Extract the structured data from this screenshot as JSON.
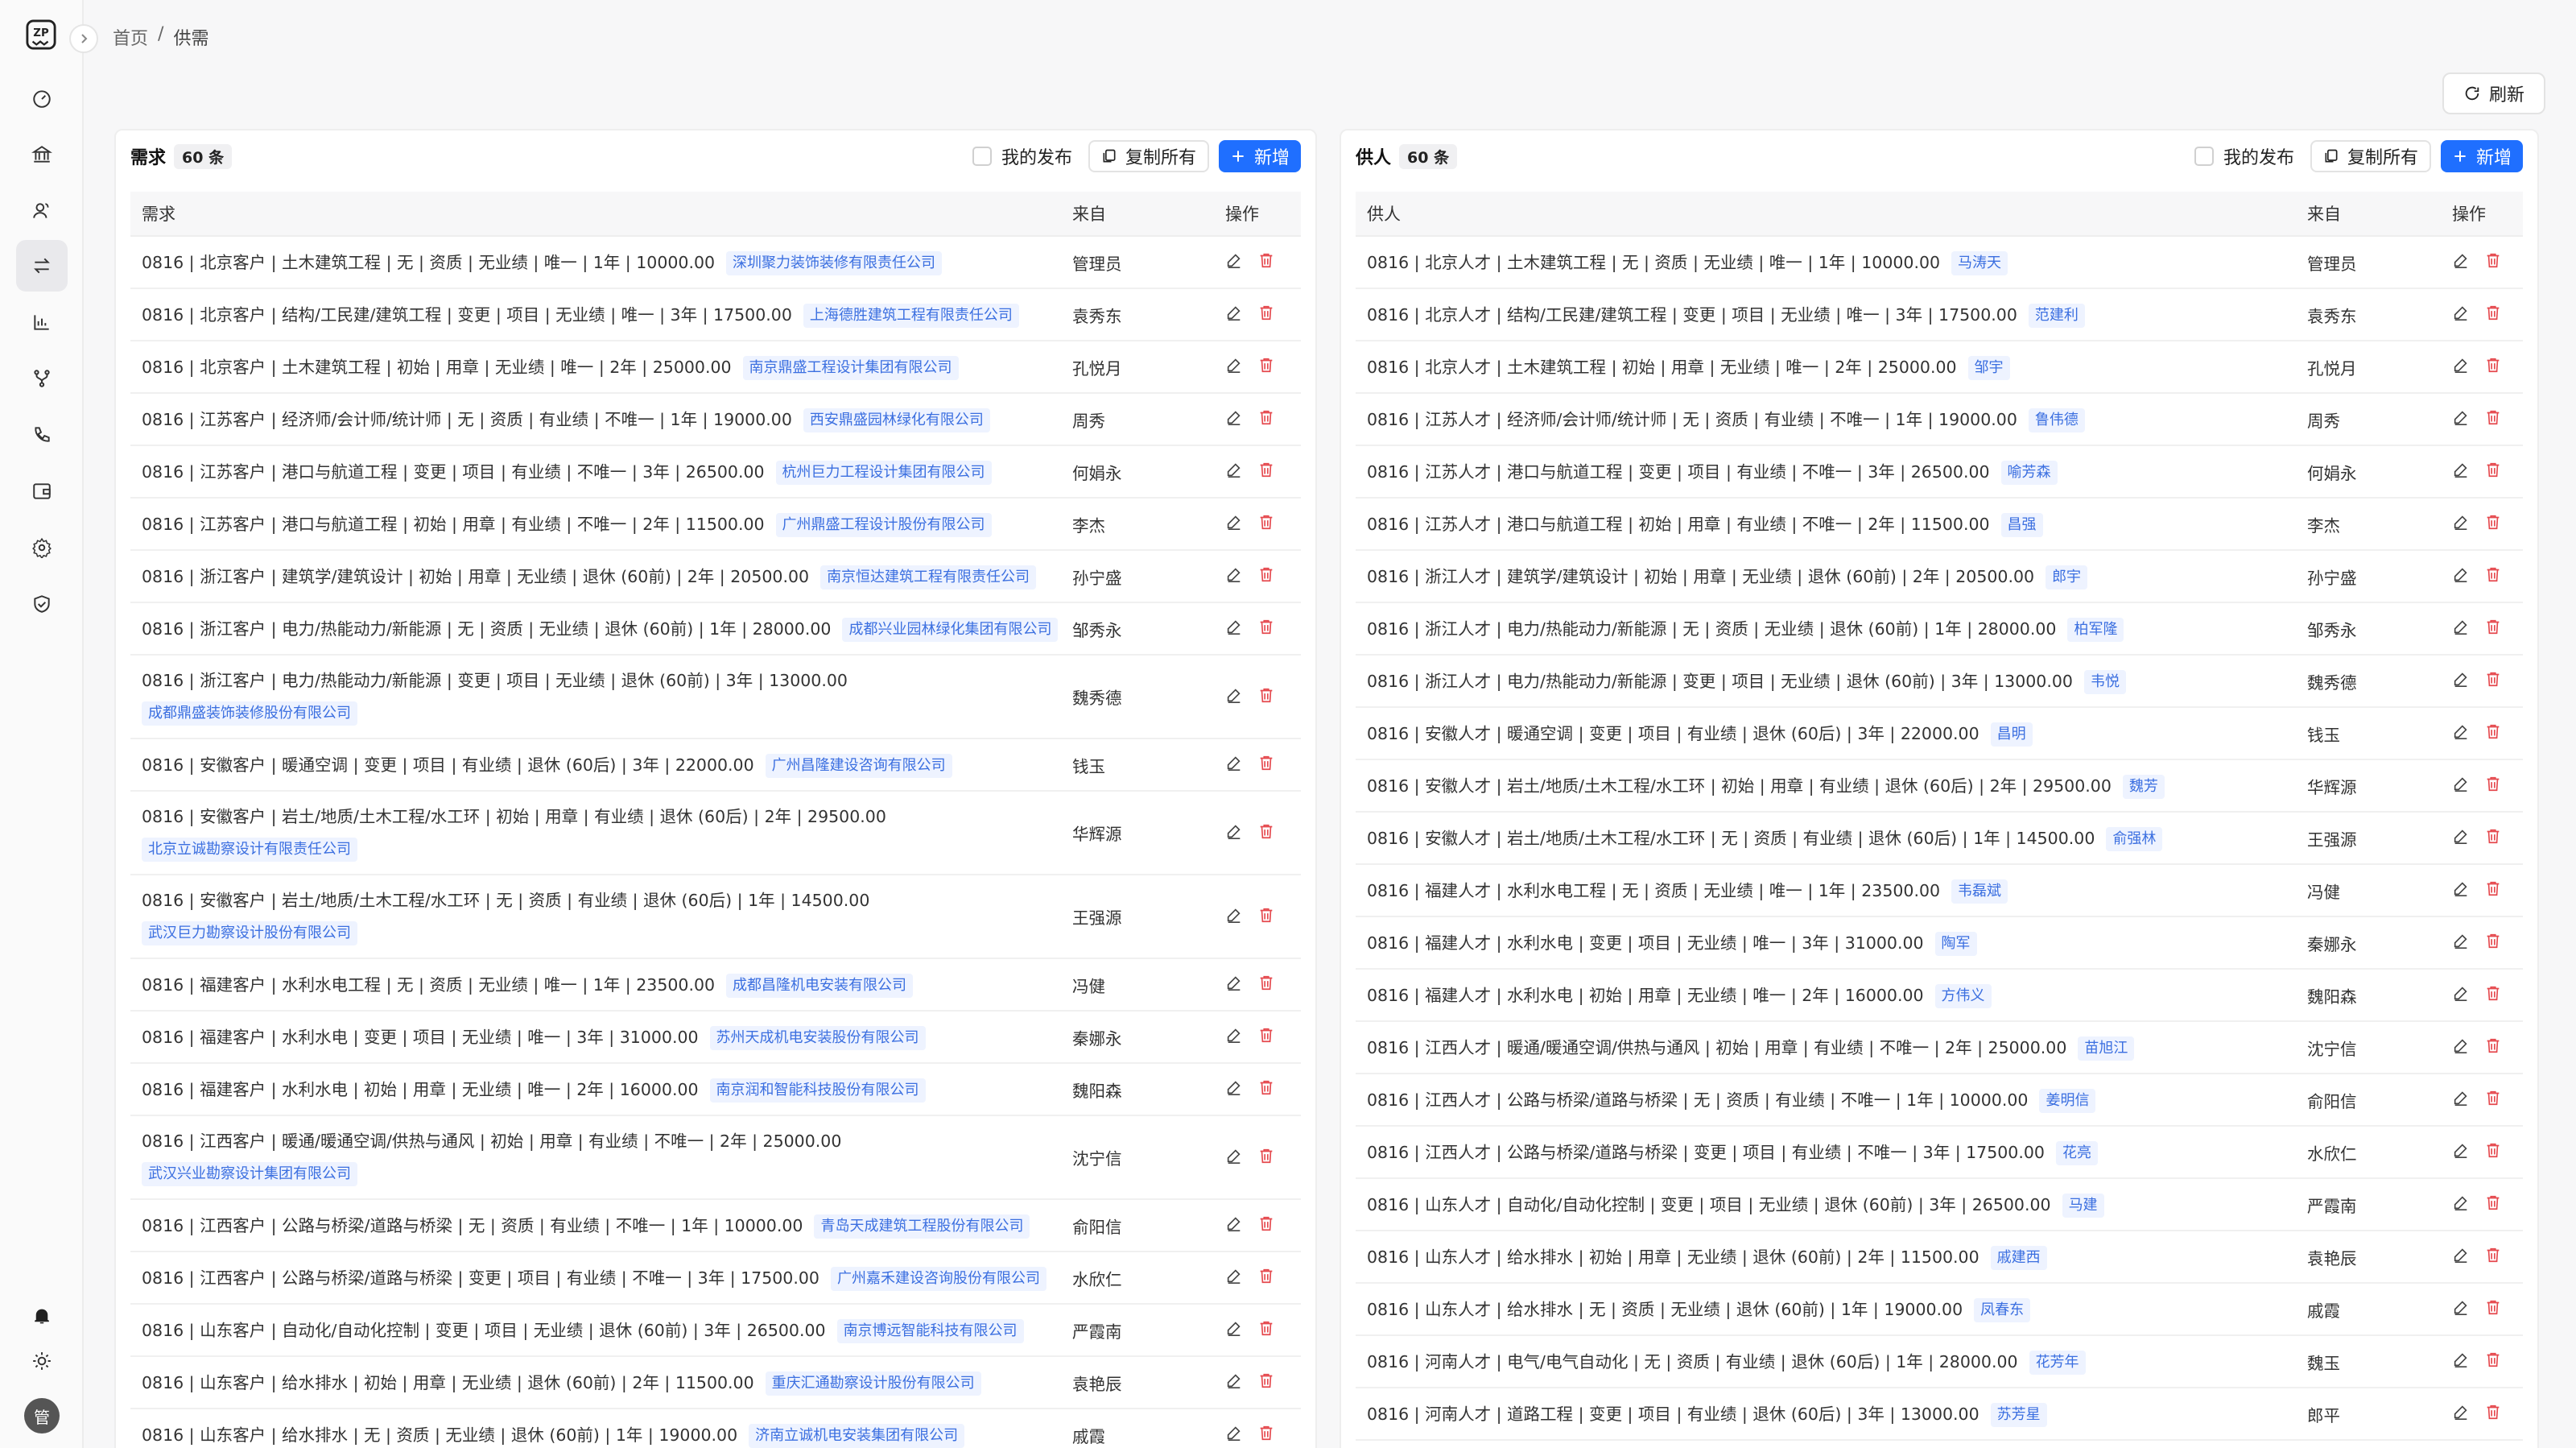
{
  "sidebar": {
    "logo": "ZP",
    "nav": [
      {
        "icon": "dashboard-icon",
        "active": false
      },
      {
        "icon": "bank-icon",
        "active": false
      },
      {
        "icon": "users-icon",
        "active": false
      },
      {
        "icon": "exchange-icon",
        "active": true
      },
      {
        "icon": "chart-icon",
        "active": false
      },
      {
        "icon": "branch-icon",
        "active": false
      },
      {
        "icon": "phone-icon",
        "active": false
      },
      {
        "icon": "wallet-icon",
        "active": false
      },
      {
        "icon": "settings-icon",
        "active": false
      },
      {
        "icon": "shield-icon",
        "active": false
      }
    ],
    "bottom": [
      {
        "icon": "bell-icon"
      },
      {
        "icon": "sun-icon"
      }
    ],
    "avatar_text": "管"
  },
  "breadcrumb": {
    "home": "首页",
    "sep": "/",
    "current": "供需"
  },
  "toolbar": {
    "refresh_label": "刷新"
  },
  "demand": {
    "title": "需求",
    "count": "60 条",
    "my_posts_label": "我的发布",
    "copy_label": "复制所有",
    "add_label": "新增",
    "columns": {
      "main": "需求",
      "from": "来自",
      "op": "操作"
    },
    "rows": [
      {
        "text": "0816 | 北京客户 | 土木建筑工程 | 无 | 资质 | 无业绩 | 唯一 | 1年 | 10000.00",
        "tag": "深圳聚力装饰装修有限责任公司",
        "from": "管理员",
        "tall": false
      },
      {
        "text": "0816 | 北京客户 | 结构/工民建/建筑工程 | 变更 | 项目 | 无业绩 | 唯一 | 3年 | 17500.00",
        "tag": "上海德胜建筑工程有限责任公司",
        "from": "袁秀东",
        "tall": false
      },
      {
        "text": "0816 | 北京客户 | 土木建筑工程 | 初始 | 用章 | 无业绩 | 唯一 | 2年 | 25000.00",
        "tag": "南京鼎盛工程设计集团有限公司",
        "from": "孔悦月",
        "tall": false
      },
      {
        "text": "0816 | 江苏客户 | 经济师/会计师/统计师 | 无 | 资质 | 有业绩 | 不唯一 | 1年 | 19000.00",
        "tag": "西安鼎盛园林绿化有限公司",
        "from": "周秀",
        "tall": false
      },
      {
        "text": "0816 | 江苏客户 | 港口与航道工程 | 变更 | 项目 | 有业绩 | 不唯一 | 3年 | 26500.00",
        "tag": "杭州巨力工程设计集团有限公司",
        "from": "何娟永",
        "tall": false
      },
      {
        "text": "0816 | 江苏客户 | 港口与航道工程 | 初始 | 用章 | 有业绩 | 不唯一 | 2年 | 11500.00",
        "tag": "广州鼎盛工程设计股份有限公司",
        "from": "李杰",
        "tall": false
      },
      {
        "text": "0816 | 浙江客户 | 建筑学/建筑设计 | 初始 | 用章 | 无业绩 | 退休 (60前) | 2年 | 20500.00",
        "tag": "南京恒达建筑工程有限责任公司",
        "from": "孙宁盛",
        "tall": false
      },
      {
        "text": "0816 | 浙江客户 | 电力/热能动力/新能源 | 无 | 资质 | 无业绩 | 退休 (60前) | 1年 | 28000.00",
        "tag": "成都兴业园林绿化集团有限公司",
        "from": "邹秀永",
        "tall": false
      },
      {
        "text": "0816 | 浙江客户 | 电力/热能动力/新能源 | 变更 | 项目 | 无业绩 | 退休 (60前) | 3年 | 13000.00",
        "tag": "成都鼎盛装饰装修股份有限公司",
        "from": "魏秀德",
        "tall": true
      },
      {
        "text": "0816 | 安徽客户 | 暖通空调 | 变更 | 项目 | 有业绩 | 退休 (60后) | 3年 | 22000.00",
        "tag": "广州昌隆建设咨询有限公司",
        "from": "钱玉",
        "tall": false
      },
      {
        "text": "0816 | 安徽客户 | 岩土/地质/土木工程/水工环 | 初始 | 用章 | 有业绩 | 退休 (60后) | 2年 | 29500.00",
        "tag": "北京立诚勘察设计有限责任公司",
        "from": "华辉源",
        "tall": true
      },
      {
        "text": "0816 | 安徽客户 | 岩土/地质/土木工程/水工环 | 无 | 资质 | 有业绩 | 退休 (60后) | 1年 | 14500.00",
        "tag": "武汉巨力勘察设计股份有限公司",
        "from": "王强源",
        "tall": true
      },
      {
        "text": "0816 | 福建客户 | 水利水电工程 | 无 | 资质 | 无业绩 | 唯一 | 1年 | 23500.00",
        "tag": "成都昌隆机电安装有限公司",
        "from": "冯健",
        "tall": false
      },
      {
        "text": "0816 | 福建客户 | 水利水电 | 变更 | 项目 | 无业绩 | 唯一 | 3年 | 31000.00",
        "tag": "苏州天成机电安装股份有限公司",
        "from": "秦娜永",
        "tall": false
      },
      {
        "text": "0816 | 福建客户 | 水利水电 | 初始 | 用章 | 无业绩 | 唯一 | 2年 | 16000.00",
        "tag": "南京润和智能科技股份有限公司",
        "from": "魏阳森",
        "tall": false
      },
      {
        "text": "0816 | 江西客户 | 暖通/暖通空调/供热与通风 | 初始 | 用章 | 有业绩 | 不唯一 | 2年 | 25000.00",
        "tag": "武汉兴业勘察设计集团有限公司",
        "from": "沈宁信",
        "tall": true
      },
      {
        "text": "0816 | 江西客户 | 公路与桥梁/道路与桥梁 | 无 | 资质 | 有业绩 | 不唯一 | 1年 | 10000.00",
        "tag": "青岛天成建筑工程股份有限公司",
        "from": "俞阳信",
        "tall": false
      },
      {
        "text": "0816 | 江西客户 | 公路与桥梁/道路与桥梁 | 变更 | 项目 | 有业绩 | 不唯一 | 3年 | 17500.00",
        "tag": "广州嘉禾建设咨询股份有限公司",
        "from": "水欣仁",
        "tall": false
      },
      {
        "text": "0816 | 山东客户 | 自动化/自动化控制 | 变更 | 项目 | 无业绩 | 退休 (60前) | 3年 | 26500.00",
        "tag": "南京博远智能科技有限公司",
        "from": "严霞南",
        "tall": false
      },
      {
        "text": "0816 | 山东客户 | 给水排水 | 初始 | 用章 | 无业绩 | 退休 (60前) | 2年 | 11500.00",
        "tag": "重庆汇通勘察设计股份有限公司",
        "from": "袁艳辰",
        "tall": false
      },
      {
        "text": "0816 | 山东客户 | 给水排水 | 无 | 资质 | 无业绩 | 退休 (60前) | 1年 | 19000.00",
        "tag": "济南立诚机电安装集团有限公司",
        "from": "戚霞",
        "tall": false
      }
    ]
  },
  "supply": {
    "title": "供人",
    "count": "60 条",
    "my_posts_label": "我的发布",
    "copy_label": "复制所有",
    "add_label": "新增",
    "columns": {
      "main": "供人",
      "from": "来自",
      "op": "操作"
    },
    "rows": [
      {
        "text": "0816 | 北京人才 | 土木建筑工程 | 无 | 资质 | 无业绩 | 唯一 | 1年 | 10000.00",
        "tag": "马涛天",
        "from": "管理员"
      },
      {
        "text": "0816 | 北京人才 | 结构/工民建/建筑工程 | 变更 | 项目 | 无业绩 | 唯一 | 3年 | 17500.00",
        "tag": "范建利",
        "from": "袁秀东"
      },
      {
        "text": "0816 | 北京人才 | 土木建筑工程 | 初始 | 用章 | 无业绩 | 唯一 | 2年 | 25000.00",
        "tag": "邹宇",
        "from": "孔悦月"
      },
      {
        "text": "0816 | 江苏人才 | 经济师/会计师/统计师 | 无 | 资质 | 有业绩 | 不唯一 | 1年 | 19000.00",
        "tag": "鲁伟德",
        "from": "周秀"
      },
      {
        "text": "0816 | 江苏人才 | 港口与航道工程 | 变更 | 项目 | 有业绩 | 不唯一 | 3年 | 26500.00",
        "tag": "喻芳森",
        "from": "何娟永"
      },
      {
        "text": "0816 | 江苏人才 | 港口与航道工程 | 初始 | 用章 | 有业绩 | 不唯一 | 2年 | 11500.00",
        "tag": "昌强",
        "from": "李杰"
      },
      {
        "text": "0816 | 浙江人才 | 建筑学/建筑设计 | 初始 | 用章 | 无业绩 | 退休 (60前) | 2年 | 20500.00",
        "tag": "郎宇",
        "from": "孙宁盛"
      },
      {
        "text": "0816 | 浙江人才 | 电力/热能动力/新能源 | 无 | 资质 | 无业绩 | 退休 (60前) | 1年 | 28000.00",
        "tag": "柏军隆",
        "from": "邹秀永"
      },
      {
        "text": "0816 | 浙江人才 | 电力/热能动力/新能源 | 变更 | 项目 | 无业绩 | 退休 (60前) | 3年 | 13000.00",
        "tag": "韦悦",
        "from": "魏秀德"
      },
      {
        "text": "0816 | 安徽人才 | 暖通空调 | 变更 | 项目 | 有业绩 | 退休 (60后) | 3年 | 22000.00",
        "tag": "昌明",
        "from": "钱玉"
      },
      {
        "text": "0816 | 安徽人才 | 岩土/地质/土木工程/水工环 | 初始 | 用章 | 有业绩 | 退休 (60后) | 2年 | 29500.00",
        "tag": "魏芳",
        "from": "华辉源"
      },
      {
        "text": "0816 | 安徽人才 | 岩土/地质/土木工程/水工环 | 无 | 资质 | 有业绩 | 退休 (60后) | 1年 | 14500.00",
        "tag": "俞强林",
        "from": "王强源"
      },
      {
        "text": "0816 | 福建人才 | 水利水电工程 | 无 | 资质 | 无业绩 | 唯一 | 1年 | 23500.00",
        "tag": "韦磊斌",
        "from": "冯健"
      },
      {
        "text": "0816 | 福建人才 | 水利水电 | 变更 | 项目 | 无业绩 | 唯一 | 3年 | 31000.00",
        "tag": "陶军",
        "from": "秦娜永"
      },
      {
        "text": "0816 | 福建人才 | 水利水电 | 初始 | 用章 | 无业绩 | 唯一 | 2年 | 16000.00",
        "tag": "方伟义",
        "from": "魏阳森"
      },
      {
        "text": "0816 | 江西人才 | 暖通/暖通空调/供热与通风 | 初始 | 用章 | 有业绩 | 不唯一 | 2年 | 25000.00",
        "tag": "苗旭江",
        "from": "沈宁信"
      },
      {
        "text": "0816 | 江西人才 | 公路与桥梁/道路与桥梁 | 无 | 资质 | 有业绩 | 不唯一 | 1年 | 10000.00",
        "tag": "姜明信",
        "from": "俞阳信"
      },
      {
        "text": "0816 | 江西人才 | 公路与桥梁/道路与桥梁 | 变更 | 项目 | 有业绩 | 不唯一 | 3年 | 17500.00",
        "tag": "花亮",
        "from": "水欣仁"
      },
      {
        "text": "0816 | 山东人才 | 自动化/自动化控制 | 变更 | 项目 | 无业绩 | 退休 (60前) | 3年 | 26500.00",
        "tag": "马建",
        "from": "严霞南"
      },
      {
        "text": "0816 | 山东人才 | 给水排水 | 初始 | 用章 | 无业绩 | 退休 (60前) | 2年 | 11500.00",
        "tag": "戚建西",
        "from": "袁艳辰"
      },
      {
        "text": "0816 | 山东人才 | 给水排水 | 无 | 资质 | 无业绩 | 退休 (60前) | 1年 | 19000.00",
        "tag": "凤春东",
        "from": "戚霞"
      },
      {
        "text": "0816 | 河南人才 | 电气/电气自动化 | 无 | 资质 | 有业绩 | 退休 (60后) | 1年 | 28000.00",
        "tag": "花芳年",
        "from": "魏玉"
      },
      {
        "text": "0816 | 河南人才 | 道路工程 | 变更 | 项目 | 有业绩 | 退休 (60后) | 3年 | 13000.00",
        "tag": "苏芳星",
        "from": "郎平"
      }
    ]
  }
}
